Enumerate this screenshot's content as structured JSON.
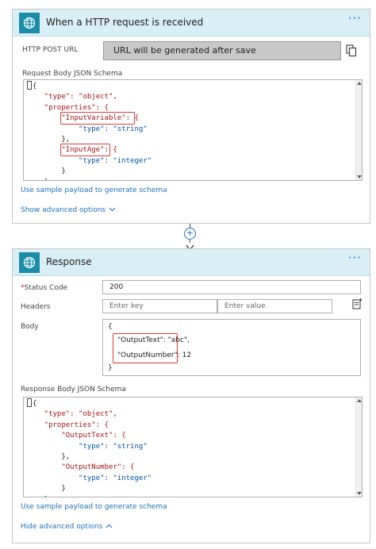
{
  "trigger": {
    "title": "When a HTTP request is received",
    "more": "···",
    "url_label": "HTTP POST URL",
    "url_value": "URL will be generated after save",
    "schema_label": "Request Body JSON Schema",
    "schema_lines": [
      "{",
      "    \"type\": \"object\",",
      "    \"properties\": {",
      "        \"InputVariable\": {",
      "            \"type\": \"string\"",
      "        },",
      "        \"InputAge\": {",
      "            \"type\": \"integer\"",
      "        }",
      "    }"
    ],
    "sample_link": "Use sample payload to generate schema",
    "advanced_link": "Show advanced options"
  },
  "response": {
    "title": "Response",
    "more": "···",
    "status_label": "Status Code",
    "status_required": "*",
    "status_value": "200",
    "headers_label": "Headers",
    "key_placeholder": "Enter key",
    "value_placeholder": "Enter value",
    "body_label": "Body",
    "body_lines": [
      "{",
      "\"OutputText\": \"abc\",",
      "\"OutputNumber\": 12",
      "}"
    ],
    "schema_label": "Response Body JSON Schema",
    "schema_lines": [
      "{",
      "    \"type\": \"object\",",
      "    \"properties\": {",
      "        \"OutputText\": {",
      "            \"type\": \"string\"",
      "        },",
      "        \"OutputNumber\": {",
      "            \"type\": \"integer\"",
      "        }",
      "    }"
    ],
    "sample_link": "Use sample payload to generate schema",
    "advanced_link": "Hide advanced options"
  },
  "connector": {
    "plus": "+"
  },
  "colors": {
    "accent": "#1b8da8",
    "header_bg": "#d9eef5",
    "link": "#1f6fbf",
    "highlight": "#e53935"
  },
  "icons": [
    "globe-icon",
    "copy-icon",
    "plus-circle-icon",
    "arrow-down-icon",
    "add-parameter-icon",
    "chevron-down-icon",
    "chevron-up-icon"
  ]
}
